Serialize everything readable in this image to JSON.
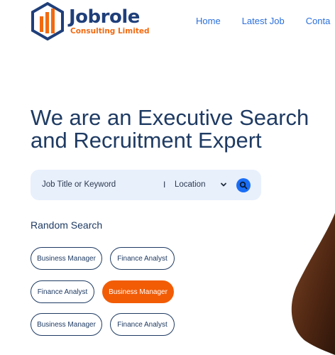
{
  "header": {
    "logo_name": "Jobrole",
    "logo_sub": "Consulting Limited",
    "nav": [
      "Home",
      "Latest Job",
      "Conta"
    ]
  },
  "hero": {
    "title_line1": "We are an Executive Search",
    "title_line2": "and Recruitment Expert"
  },
  "search": {
    "keyword_placeholder": "Job Title or Keyword",
    "divider": "I",
    "location_label": "Location",
    "icons": {
      "dropdown": "chevron-down-icon",
      "submit": "search-icon"
    }
  },
  "random_search": {
    "heading": "Random Search",
    "tags": [
      {
        "label": "Business Manager",
        "active": false
      },
      {
        "label": "Finance Analyst",
        "active": false
      },
      {
        "label": "Finance Analyst",
        "active": false
      },
      {
        "label": "Business Manager",
        "active": true
      },
      {
        "label": "Business Manager",
        "active": false
      },
      {
        "label": "Finance Analyst",
        "active": false
      }
    ]
  },
  "colors": {
    "brand_navy": "#1f3f7a",
    "brand_orange": "#f26a10",
    "active_tag": "#f25c05",
    "search_bg": "#e8f0fc",
    "search_button": "#1a6ef5",
    "nav_link": "#2a6fdb"
  }
}
